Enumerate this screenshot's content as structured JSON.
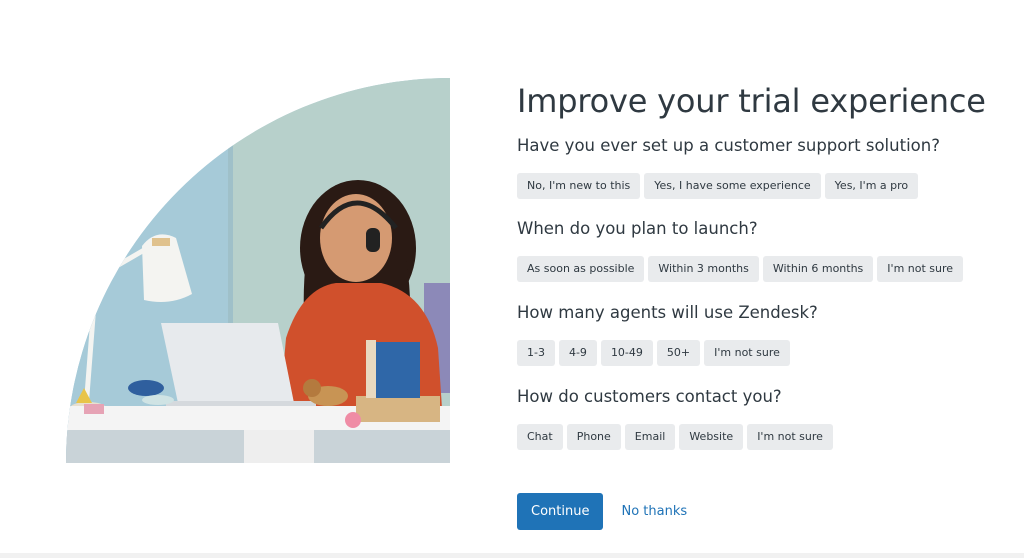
{
  "form": {
    "title": "Improve your trial experience",
    "questions": [
      {
        "label": "Have you ever set up a customer support solution?",
        "options": [
          "No, I'm new to this",
          "Yes, I have some experience",
          "Yes, I'm a pro"
        ]
      },
      {
        "label": "When do you plan to launch?",
        "options": [
          "As soon as possible",
          "Within 3 months",
          "Within 6 months",
          "I'm not sure"
        ]
      },
      {
        "label": "How many agents will use Zendesk?",
        "options": [
          "1-3",
          "4-9",
          "10-49",
          "50+",
          "I'm not sure"
        ]
      },
      {
        "label": "How do customers contact you?",
        "options": [
          "Chat",
          "Phone",
          "Email",
          "Website",
          "I'm not sure"
        ]
      }
    ],
    "continue_label": "Continue",
    "no_thanks_label": "No thanks"
  },
  "colors": {
    "accent": "#1f73b7",
    "option_bg": "#e9ebed",
    "text": "#2f3941"
  }
}
